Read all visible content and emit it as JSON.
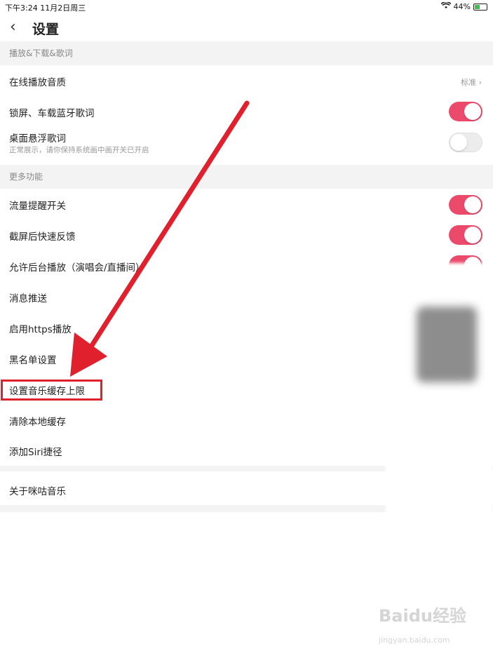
{
  "status_bar": {
    "time_date": "下午3:24   11月2日周三",
    "battery": "44%",
    "battery_level": 0.44
  },
  "header": {
    "back_glyph": "‹",
    "title": "设置"
  },
  "sections": {
    "playback": "播放&下载&歌词",
    "more": "更多功能"
  },
  "items": {
    "quality": {
      "label": "在线播放音质",
      "value": "标准 ›"
    },
    "lockscreen_lyrics": {
      "label": "锁屏、车载蓝牙歌词",
      "on": true
    },
    "desktop_lyrics": {
      "label": "桌面悬浮歌词",
      "sub": "正常展示，请你保持系统画中画开关已开启",
      "on": false
    },
    "traffic_alert": {
      "label": "流量提醒开关",
      "on": true
    },
    "screenshot_feedback": {
      "label": "截屏后快速反馈",
      "on": true
    },
    "background_play": {
      "label": "允许后台播放（演唱会/直播间）",
      "on": true
    },
    "push": {
      "label": "消息推送"
    },
    "https": {
      "label": "启用https播放"
    },
    "blacklist": {
      "label": "黑名单设置"
    },
    "cache_limit": {
      "label": "设置音乐缓存上限"
    },
    "clear_cache": {
      "label": "清除本地缓存"
    },
    "siri": {
      "label": "添加Siri捷径"
    },
    "about": {
      "label": "关于咪咕音乐"
    }
  },
  "colors": {
    "toggle_on": "#ec4a6b",
    "highlight": "#e0202c",
    "arrow": "#e0202c"
  },
  "watermark": {
    "brand": "Baidu经验",
    "url": "jingyan.baidu.com"
  }
}
